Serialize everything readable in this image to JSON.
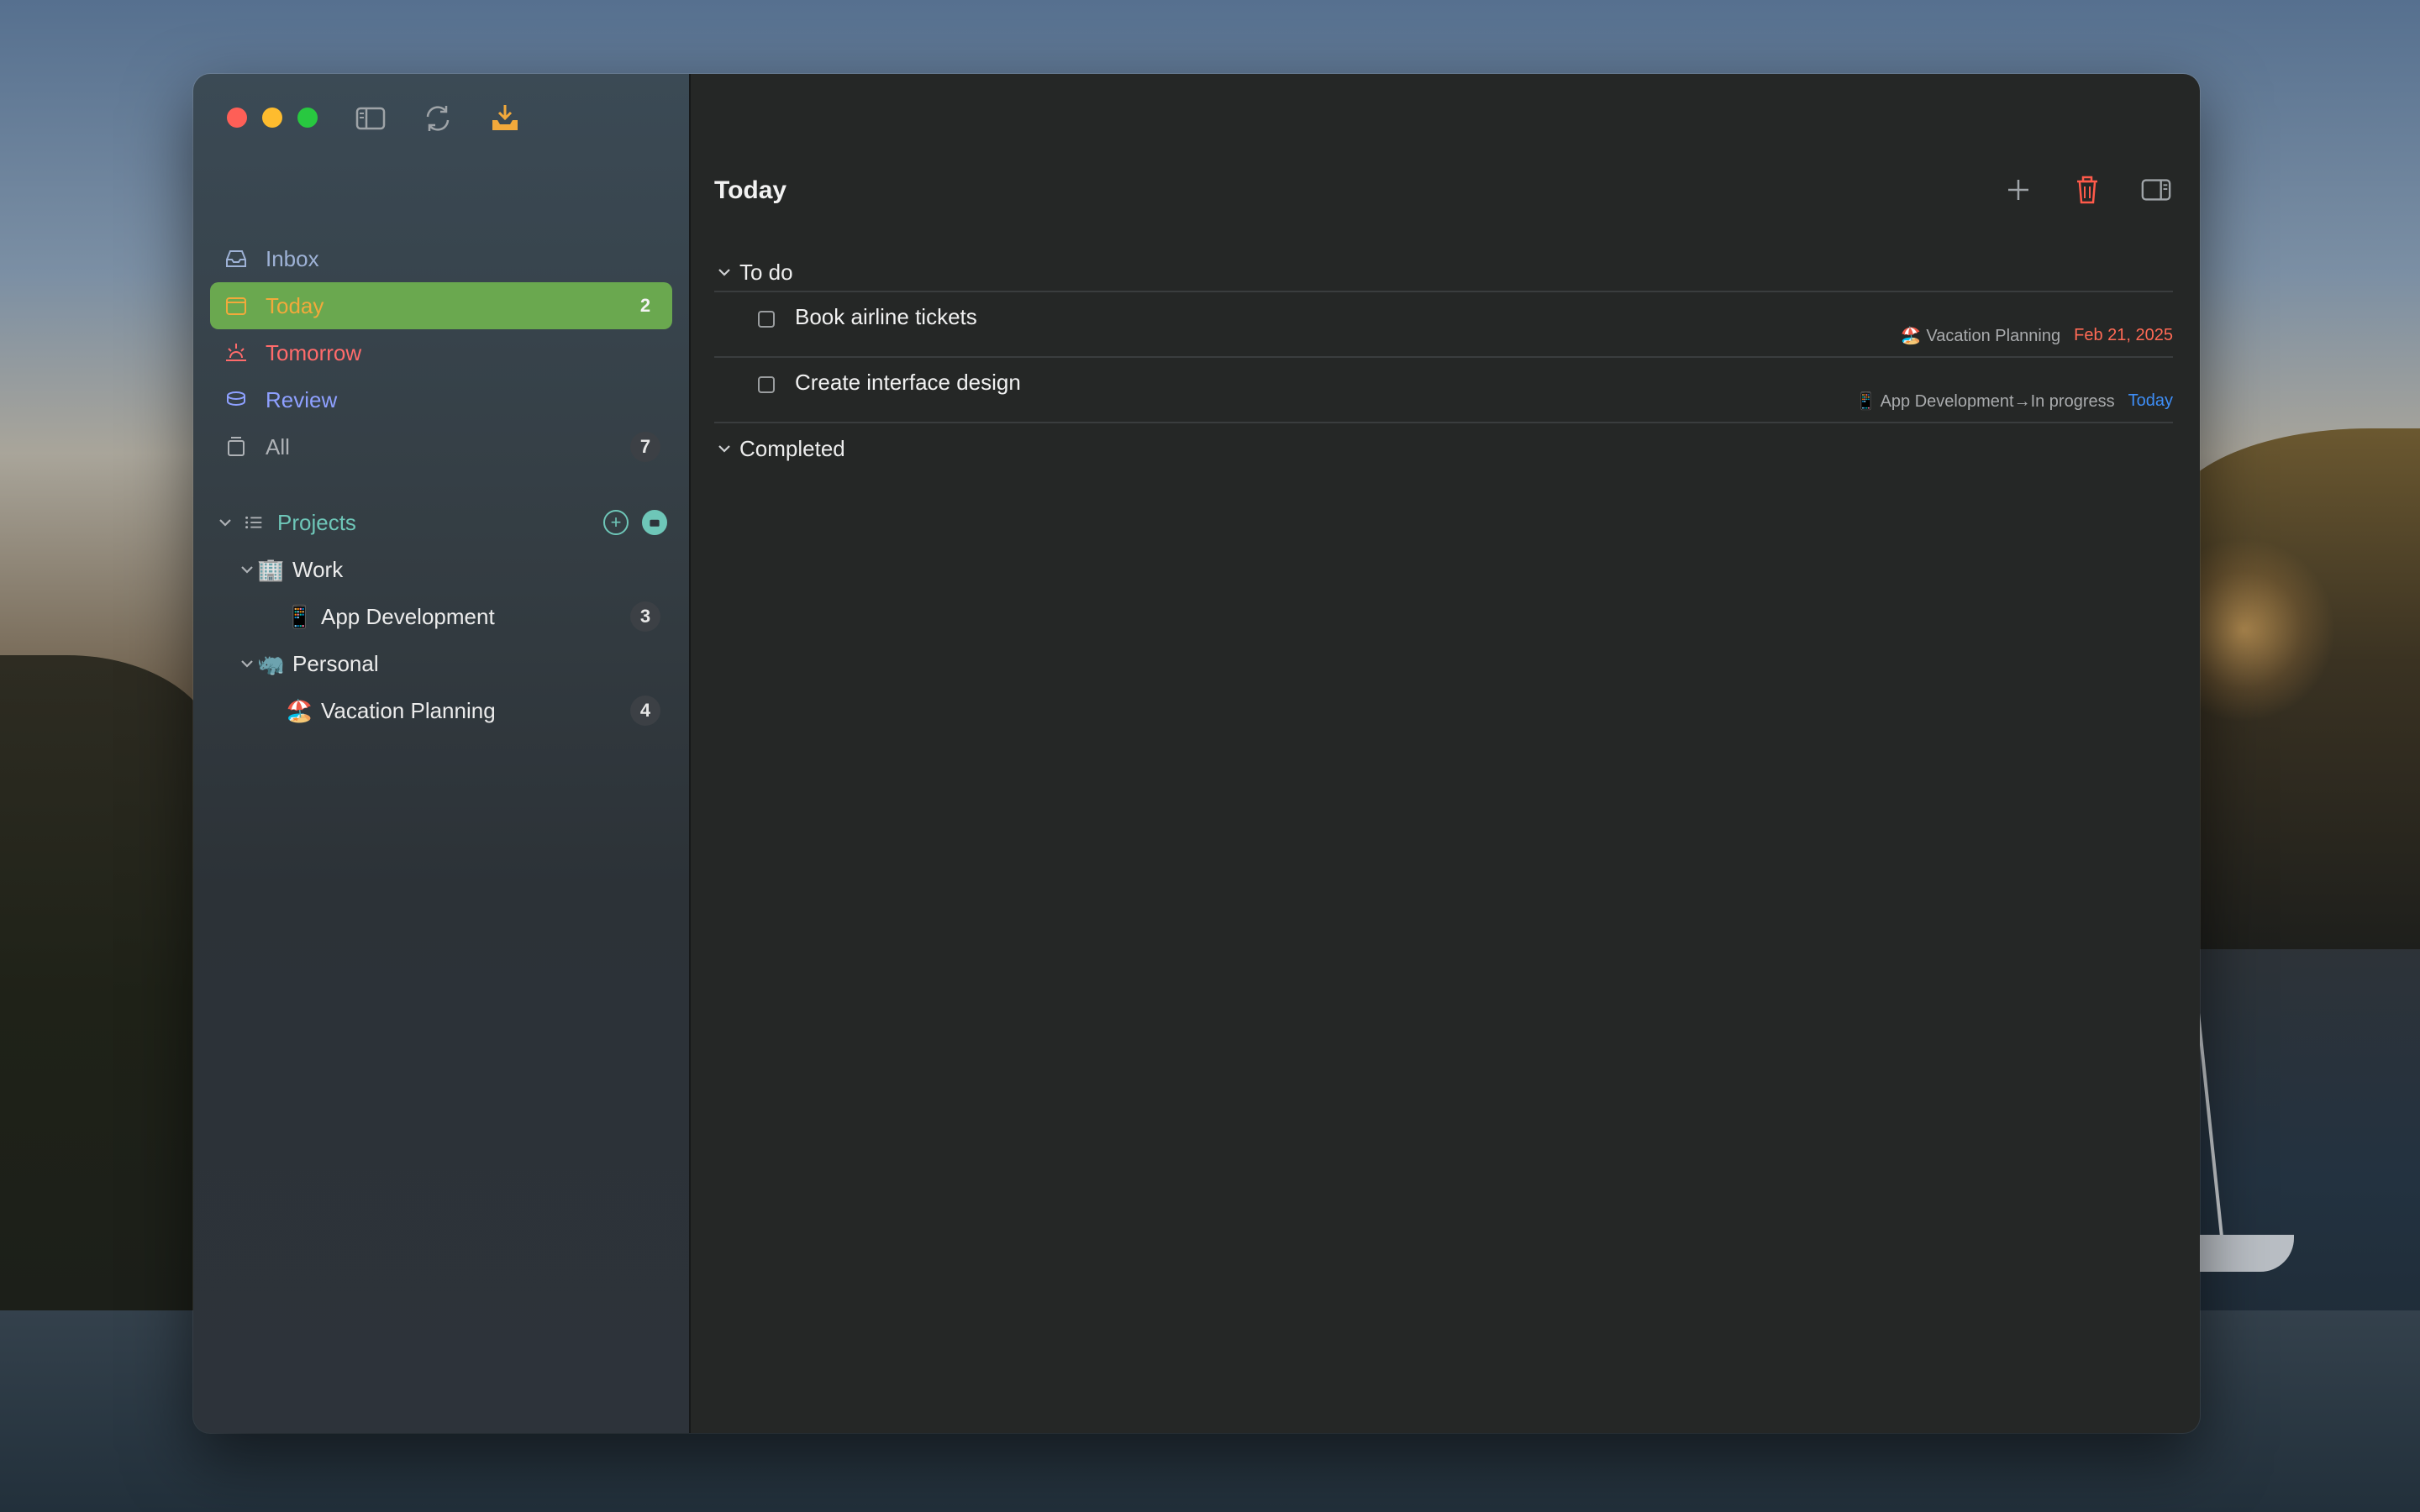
{
  "colors": {
    "accent_green": "#6aa84f",
    "today_label": "#f2a93b",
    "tomorrow_label": "#ff6b6b",
    "review_label": "#8ea0ff",
    "inbox_label": "#9eb2d6",
    "projects_label": "#6ec6b8",
    "date_overdue": "#ff6a55",
    "date_today": "#3e8ef7",
    "trash_red": "#ff5a4a"
  },
  "sidebar": {
    "nav": [
      {
        "label": "Inbox",
        "icon": "inbox-tray-icon",
        "count": ""
      },
      {
        "label": "Today",
        "icon": "calendar-icon",
        "count": "2"
      },
      {
        "label": "Tomorrow",
        "icon": "sunrise-icon",
        "count": ""
      },
      {
        "label": "Review",
        "icon": "stack-icon",
        "count": ""
      },
      {
        "label": "All",
        "icon": "archive-icon",
        "count": "7"
      }
    ],
    "projects": {
      "label": "Projects",
      "groups": [
        {
          "label": "Work",
          "emoji": "🏢",
          "items": [
            {
              "label": "App Development",
              "emoji": "📱",
              "count": "3"
            }
          ]
        },
        {
          "label": "Personal",
          "emoji": "🦏",
          "items": [
            {
              "label": "Vacation Planning",
              "emoji": "🏖️",
              "count": "4"
            }
          ]
        }
      ]
    }
  },
  "main": {
    "title": "Today",
    "sections": {
      "todo": {
        "label": "To do",
        "tasks": [
          {
            "name": "Book airline tickets",
            "project_emoji": "🏖️",
            "project": "Vacation Planning",
            "date": "Feb 21, 2025"
          },
          {
            "name": "Create interface design",
            "project_emoji": "📱",
            "project": "App Development→In progress",
            "date": "Today"
          }
        ]
      },
      "completed": {
        "label": "Completed"
      }
    }
  }
}
